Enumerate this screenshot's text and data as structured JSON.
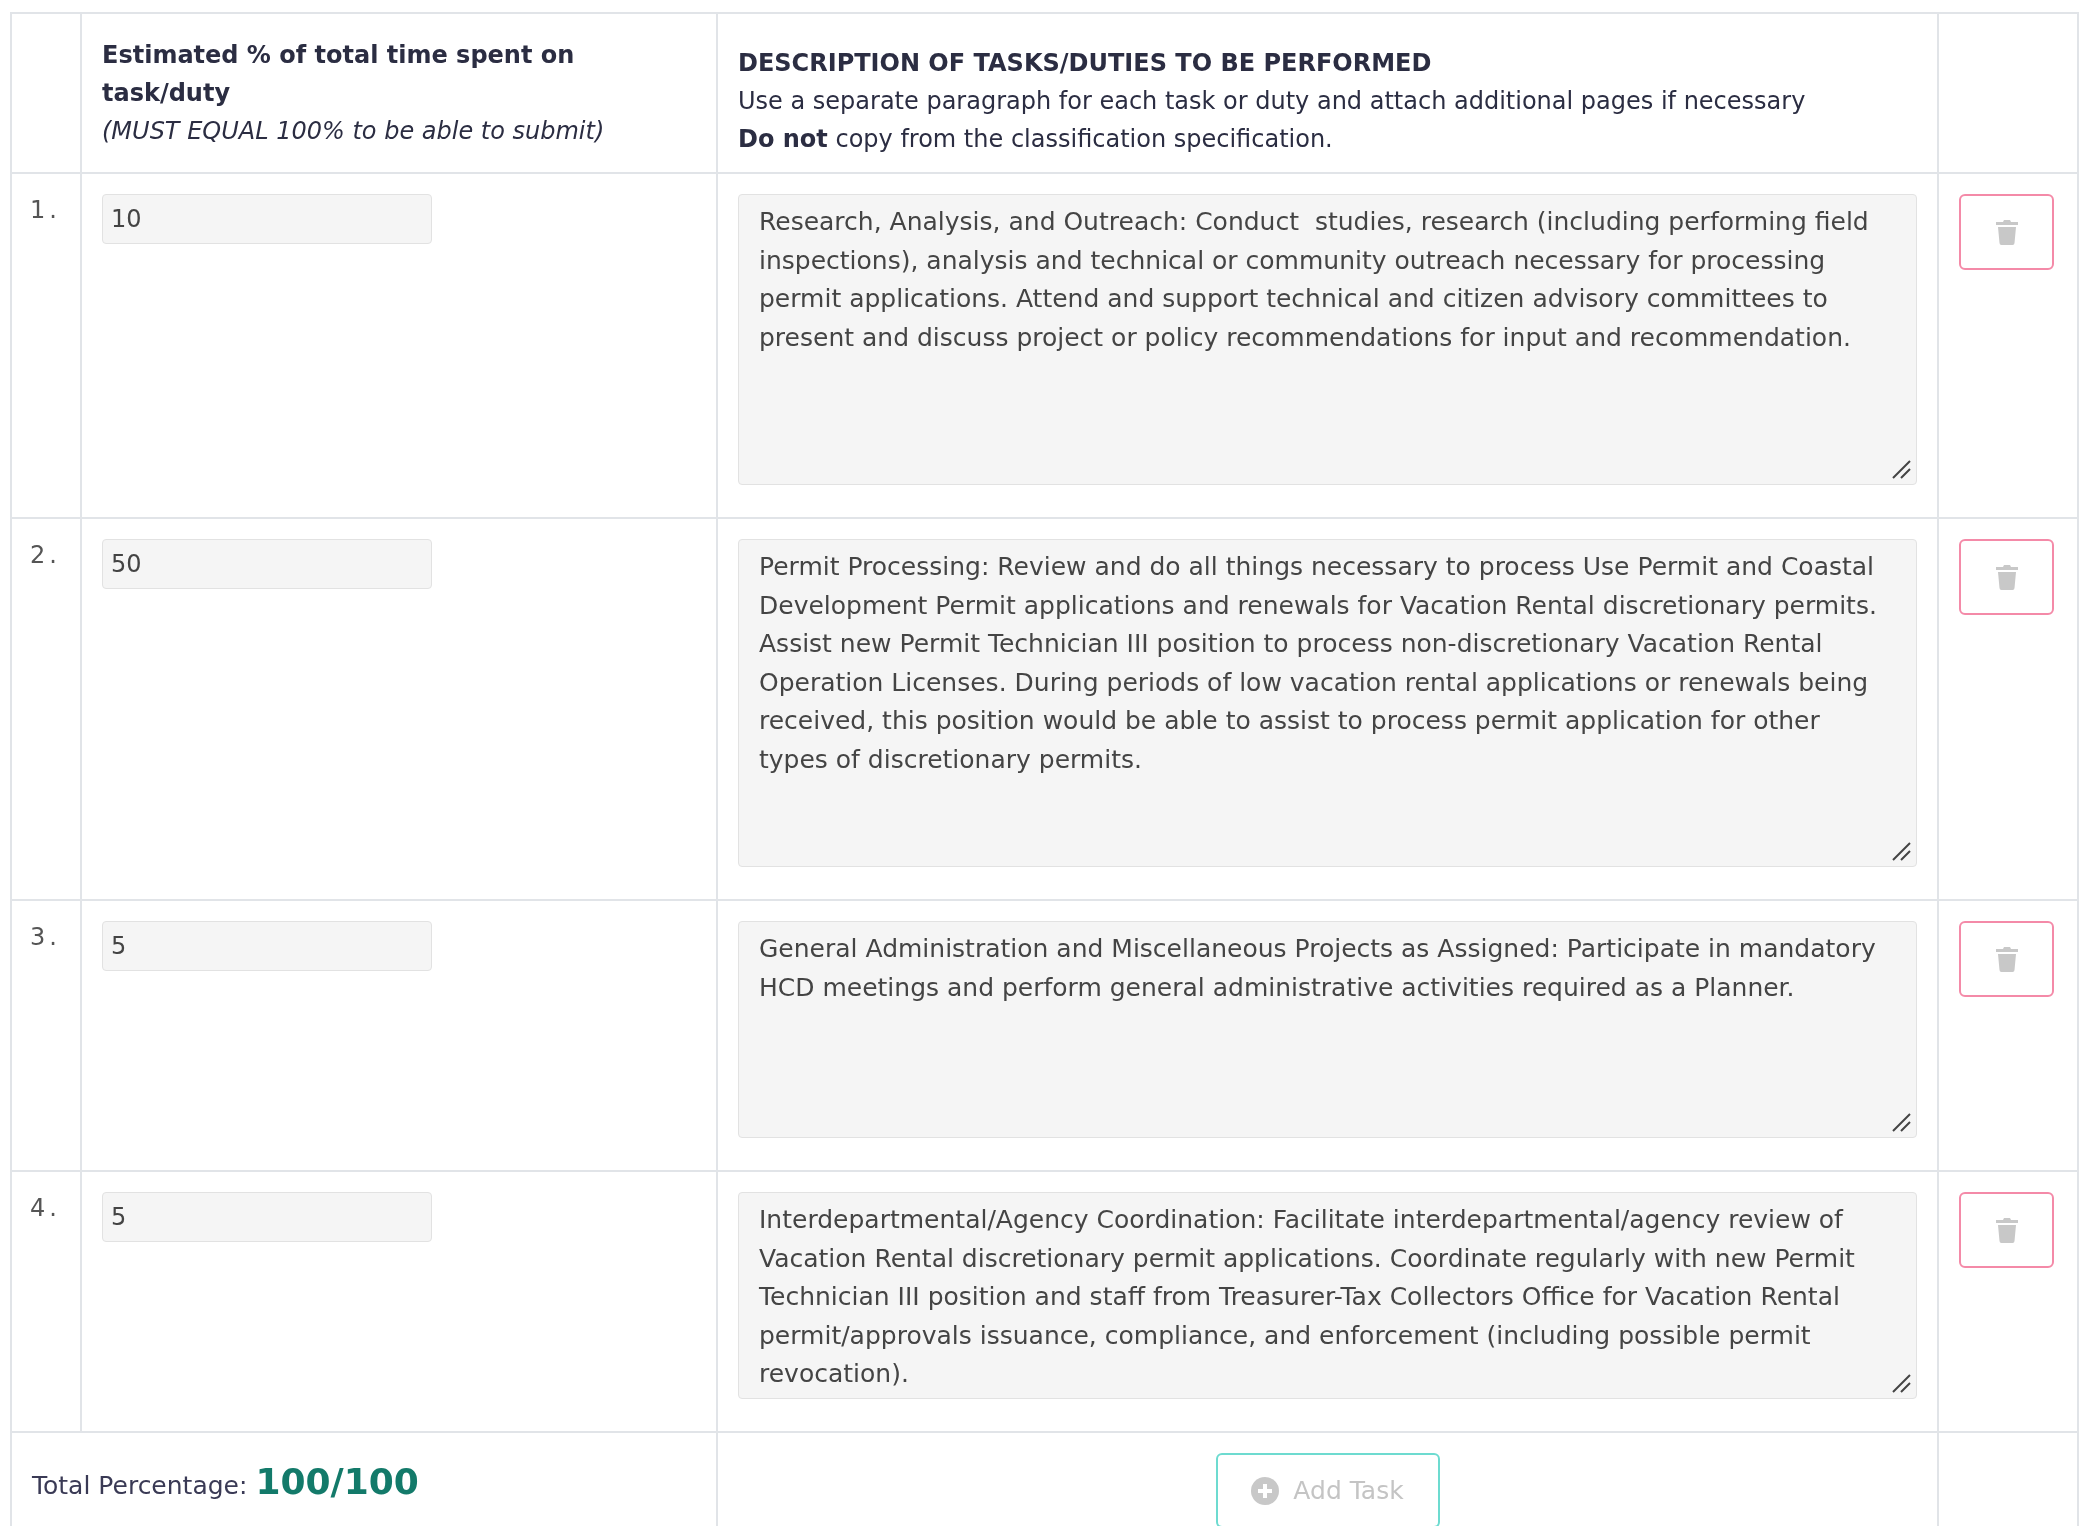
{
  "table": {
    "header": {
      "percent_title": "Estimated % of total time spent on task/duty",
      "percent_note": "(MUST EQUAL 100% to be able to submit)",
      "description_title": "DESCRIPTION OF TASKS/DUTIES TO BE PERFORMED",
      "description_note": "Use a separate paragraph for each task or duty and attach additional pages if necessary",
      "description_warning": "**Do not** copy from the classification specification."
    },
    "rows": [
      {
        "number": "1.",
        "percent": "10",
        "description": "Research, Analysis, and Outreach: Conduct  studies, research (including performing field inspections), analysis and technical or community outreach necessary for processing permit applications. Attend and support technical and citizen advisory committees to present and discuss project or policy recommendations for input and recommendation."
      },
      {
        "number": "2.",
        "percent": "50",
        "description": "Permit Processing: Review and do all things necessary to process Use Permit and Coastal Development Permit applications and renewals for Vacation Rental discretionary permits. Assist new Permit Technician III position to process non-discretionary Vacation Rental Operation Licenses. During periods of low vacation rental applications or renewals being received, this position would be able to assist to process permit application for other types of discretionary permits."
      },
      {
        "number": "3.",
        "percent": "5",
        "description": "General Administration and Miscellaneous Projects as Assigned: Participate in mandatory HCD meetings and perform general administrative activities required as a Planner."
      },
      {
        "number": "4.",
        "percent": "5",
        "description": "Interdepartmental/Agency Coordination: Facilitate interdepartmental/agency review of Vacation Rental discretionary permit applications. Coordinate regularly with new Permit Technician III position and staff from Treasurer-Tax Collectors Office for Vacation Rental permit/approvals issuance, compliance, and enforcement (including possible permit revocation)."
      }
    ],
    "footer": {
      "total_label": "Total Percentage:",
      "total_value": "100/100",
      "add_button": {
        "label": "Add Task",
        "disabled": true
      }
    }
  }
}
